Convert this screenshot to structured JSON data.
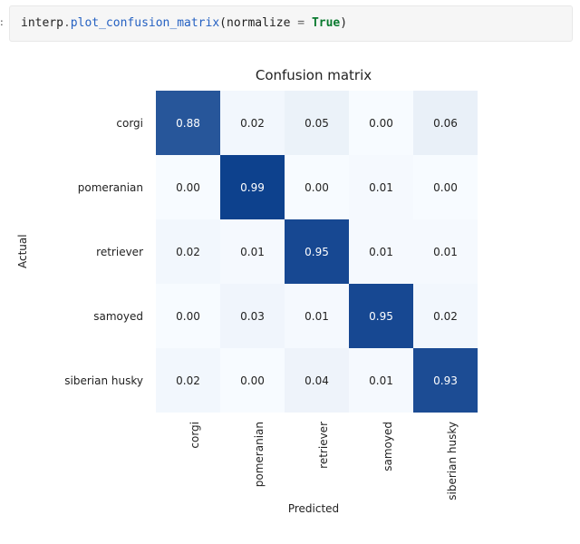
{
  "code": {
    "obj": "interp",
    "dot": ".",
    "method": "plot_confusion_matrix",
    "lpar": "(",
    "kw": "normalize",
    "eq": " = ",
    "val": "True",
    "rpar": ")"
  },
  "chart_data": {
    "type": "heatmap",
    "title": "Confusion matrix",
    "xlabel": "Predicted",
    "ylabel": "Actual",
    "categories": [
      "corgi",
      "pomeranian",
      "retriever",
      "samoyed",
      "siberian husky"
    ],
    "matrix": [
      [
        0.88,
        0.02,
        0.05,
        0.0,
        0.06
      ],
      [
        0.0,
        0.99,
        0.0,
        0.01,
        0.0
      ],
      [
        0.02,
        0.01,
        0.95,
        0.01,
        0.01
      ],
      [
        0.0,
        0.03,
        0.01,
        0.95,
        0.02
      ],
      [
        0.02,
        0.0,
        0.04,
        0.01,
        0.93
      ]
    ],
    "colormap": {
      "low": "#f7fbff",
      "mid": "#5a9bd4",
      "high": "#0b3f8c"
    }
  }
}
